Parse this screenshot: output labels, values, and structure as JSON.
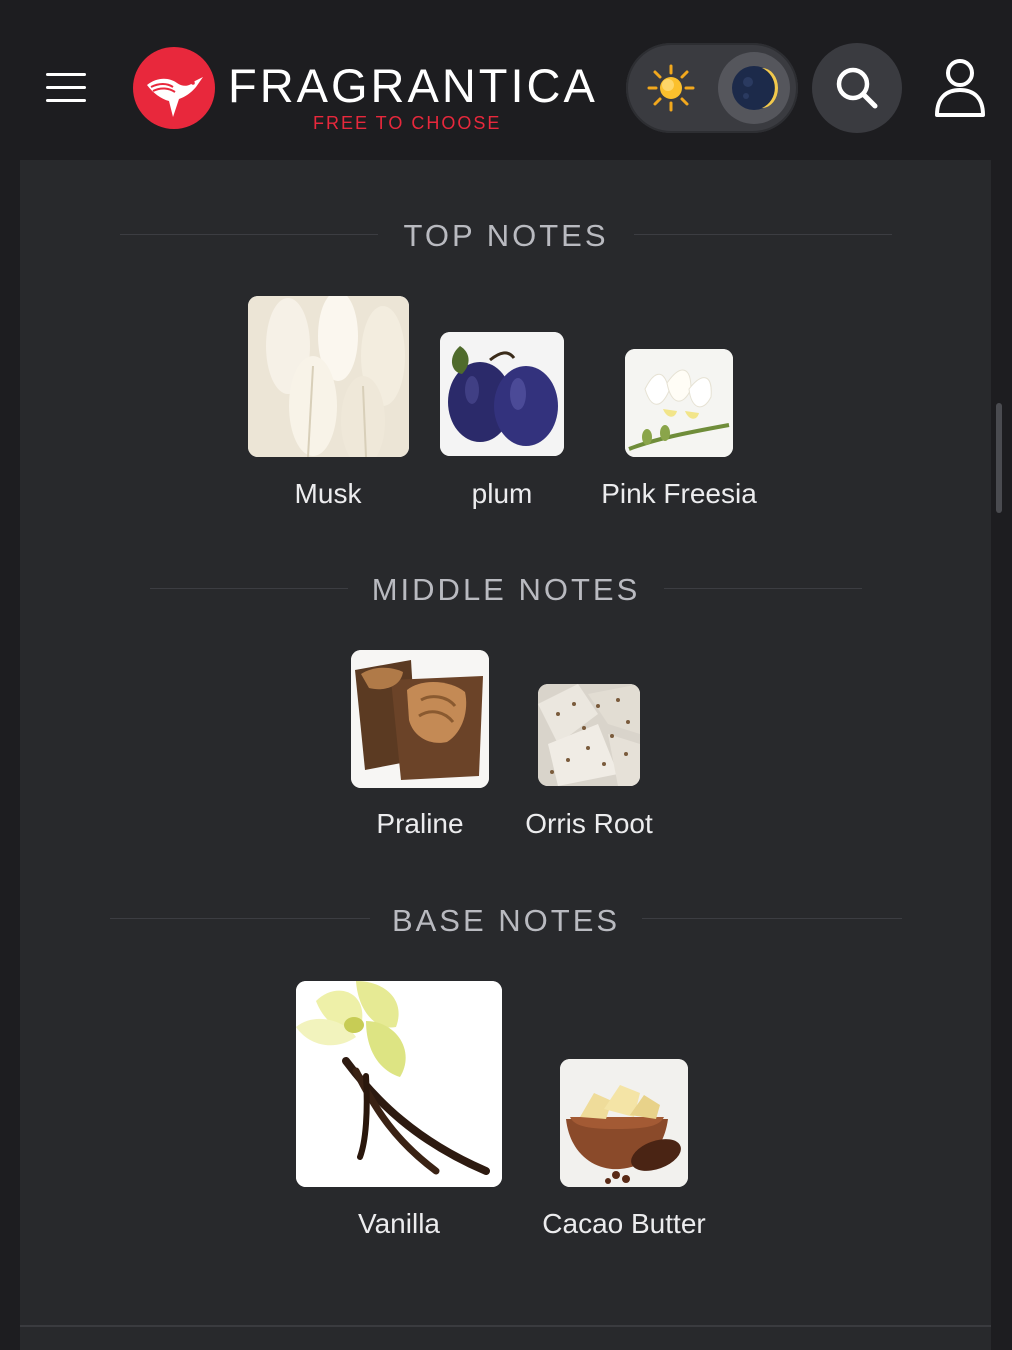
{
  "header": {
    "brand_name": "FRAGRANTICA",
    "tagline": "FREE TO CHOOSE",
    "colors": {
      "brand": "#e8283c",
      "background": "#1d1d20"
    },
    "icons": [
      "menu-icon",
      "hummingbird-logo",
      "sun-icon",
      "moon-icon",
      "search-icon",
      "user-icon"
    ]
  },
  "pyramid": {
    "top": {
      "title": "TOP NOTES",
      "notes": [
        {
          "label": "Musk",
          "image": "musk"
        },
        {
          "label": "plum",
          "image": "plum"
        },
        {
          "label": "Pink Freesia",
          "image": "freesia"
        }
      ]
    },
    "middle": {
      "title": "MIDDLE NOTES",
      "notes": [
        {
          "label": "Praline",
          "image": "praline"
        },
        {
          "label": "Orris Root",
          "image": "orris-root"
        }
      ]
    },
    "base": {
      "title": "BASE NOTES",
      "notes": [
        {
          "label": "Vanilla",
          "image": "vanilla"
        },
        {
          "label": "Cacao Butter",
          "image": "cacao-butter"
        }
      ]
    }
  }
}
